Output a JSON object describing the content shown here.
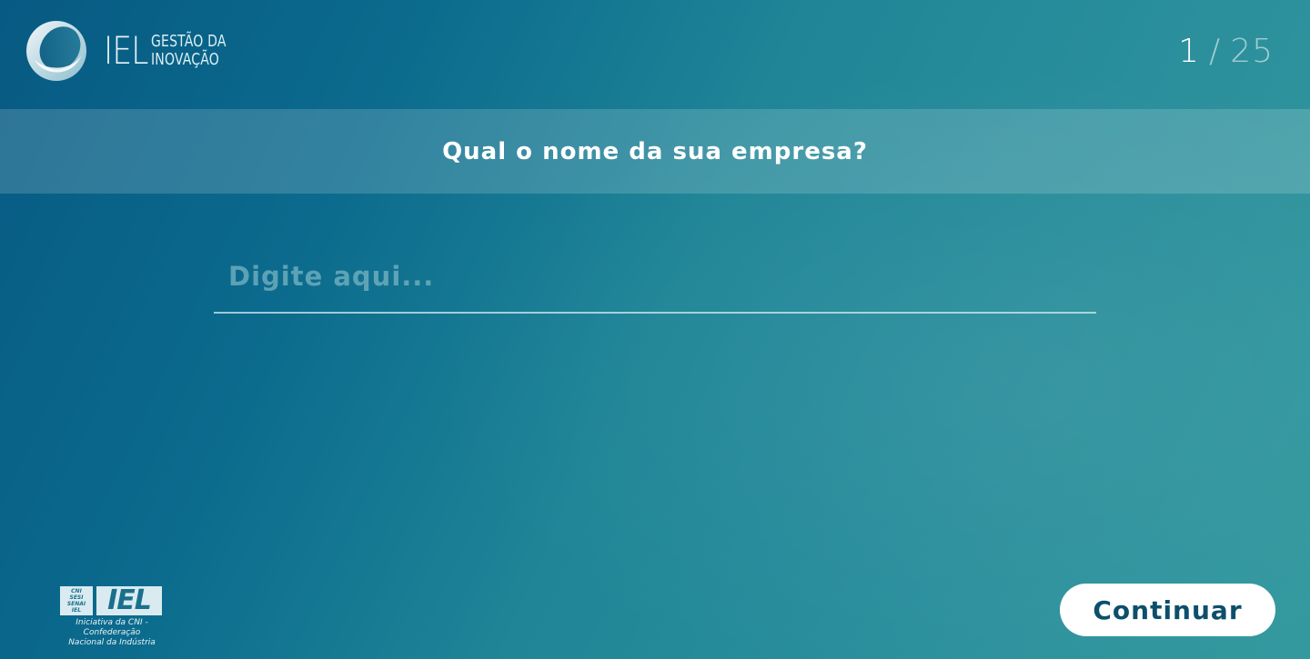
{
  "header": {
    "brand_name": "IEL",
    "brand_sub_line1": "GESTÃO DA",
    "brand_sub_line2": "INOVAÇÃO",
    "logo_icon": "iel-circle-logo-icon"
  },
  "progress": {
    "current": "1",
    "separator": "/",
    "total": "25"
  },
  "question": {
    "text": "Qual o nome da sua empresa?"
  },
  "answer": {
    "value": "",
    "placeholder": "Digite aqui..."
  },
  "footer": {
    "logo_text": "IEL",
    "small_box_lines": [
      "CNI",
      "SESI",
      "SENAI",
      "IEL"
    ],
    "caption_line1": "Iniciativa da CNI - Confederação",
    "caption_line2": "Nacional da Indústria"
  },
  "actions": {
    "continue_label": "Continuar"
  },
  "colors": {
    "background_start": "#075a83",
    "background_end": "#34999f",
    "button_text": "#0d4f6b",
    "button_bg": "#ffffff"
  }
}
